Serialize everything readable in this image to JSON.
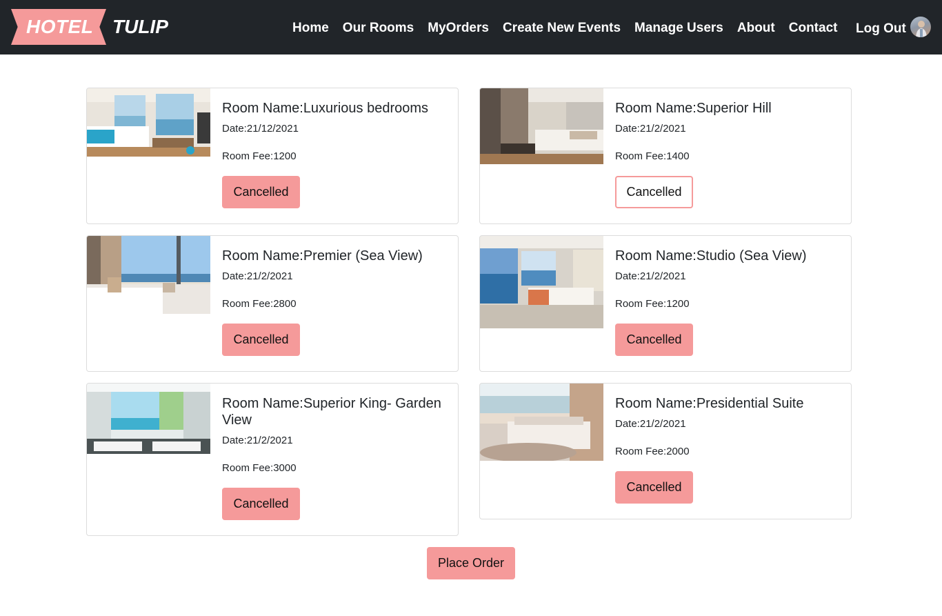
{
  "brand": {
    "part1": "HOTEL",
    "part2": "TULIP"
  },
  "nav": {
    "links": [
      "Home",
      "Our Rooms",
      "MyOrders",
      "Create New Events",
      "Manage Users",
      "About",
      "Contact"
    ],
    "logout": "Log Out"
  },
  "orders": [
    {
      "name": "Room Name:Luxurious bedrooms",
      "date": "Date:21/12/2021",
      "fee": "Room Fee:1200",
      "status": "Cancelled"
    },
    {
      "name": "Room Name:Superior Hill",
      "date": "Date:21/2/2021",
      "fee": "Room Fee:1400",
      "status": "Cancelled"
    },
    {
      "name": "Room Name:Premier (Sea View)",
      "date": "Date:21/2/2021",
      "fee": "Room Fee:2800",
      "status": "Cancelled"
    },
    {
      "name": "Room Name:Studio (Sea View)",
      "date": "Date:21/2/2021",
      "fee": "Room Fee:1200",
      "status": "Cancelled"
    },
    {
      "name": "Room Name:Superior King- Garden View",
      "date": "Date:21/2/2021",
      "fee": "Room Fee:3000",
      "status": "Cancelled"
    },
    {
      "name": "Room Name:Presidential Suite",
      "date": "Date:21/2/2021",
      "fee": "Room Fee:2000",
      "status": "Cancelled"
    }
  ],
  "place_order": "Place Order",
  "colors": {
    "navbar": "#212529",
    "accent": "#f59a9a",
    "card_border": "#dcdcdc"
  }
}
